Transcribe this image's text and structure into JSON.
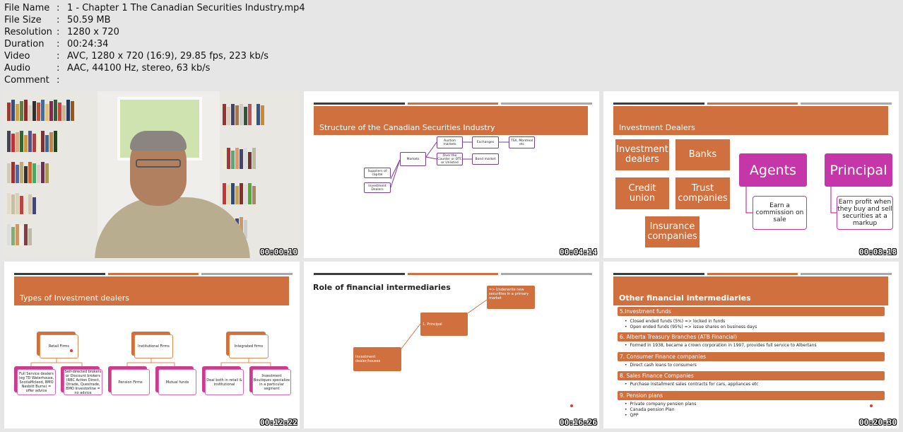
{
  "metadata": [
    {
      "key": "File Name",
      "value": "1 - Chapter 1 The Canadian Securities Industry.mp4"
    },
    {
      "key": "File Size",
      "value": "50.59 MB"
    },
    {
      "key": "Resolution",
      "value": "1280 x 720"
    },
    {
      "key": "Duration",
      "value": "00:24:34"
    },
    {
      "key": "Video",
      "value": "AVC, 1280 x 720 (16:9), 29.85 fps, 223 kb/s"
    },
    {
      "key": "Audio",
      "value": "AAC, 44100 Hz, stereo, 63 kb/s"
    },
    {
      "key": "Comment",
      "value": ""
    }
  ],
  "separator": ":",
  "thumbnails": {
    "t1": {
      "timestamp": "00:00:10"
    },
    "t2": {
      "timestamp": "00:04:14",
      "title": "Structure of the Canadian Securities Industry",
      "boxes": {
        "suppliers": "Suppliers of capital",
        "dealers": "Investment Dealers",
        "markets": "Markets",
        "auction": "Auction markets",
        "otc": "Over the Counter or OTC or Unlisted",
        "exchanges": "Exchanges",
        "bond": "Bond market",
        "tsx": "TSX, Montreal etc"
      }
    },
    "t3": {
      "timestamp": "00:08:18",
      "title": "Investment Dealers",
      "investment_dealers": "Investment dealers",
      "banks": "Banks",
      "credit_union": "Credit union",
      "trust": "Trust companies",
      "insurance": "Insurance companies",
      "agents": "Agents",
      "principal": "Principal",
      "agents_note": "Earn a commission on sale",
      "principal_note": "Earn profit when they buy and sell securities at a markup"
    },
    "t4": {
      "timestamp": "00:12:22",
      "title": "Types of Investment dealers",
      "retail": "Retail Firms",
      "institutional": "Institutional Firms",
      "integrated": "Integrated firms",
      "full_service": "Full Service dealers (eg TD Waterhouse, ScotiaMcleod, BMO Nesbitt Burns) = offer advice",
      "self_directed": "Self-directed brokers or Discount brokers (RBC Action Direct, Qtrade, Questrade, BMO Investorline = no advice",
      "pension": "Pension Firms",
      "mutual": "Mutual funds",
      "deal_both": "Deal both in retail & institutional",
      "boutiques": "Investment Boutiques specialize in a particular segment"
    },
    "t5": {
      "timestamp": "00:16:26",
      "title": "Role of financial intermediaries",
      "dealer_box": "Investment dealer/houses",
      "principal_box": "1. Principal",
      "underwrite_box": "=> Underwrite new securities in a primary market"
    },
    "t6": {
      "timestamp": "00:20:30",
      "title": "Other financial intermediaries",
      "sections": [
        {
          "heading": "5.Investment funds",
          "bullets": [
            "Closed ended funds (5%) => locked in funds",
            "Open ended funds (95%) => issue shares on business days"
          ]
        },
        {
          "heading": "6. Alberta Treasury Branches (ATB Financial)",
          "bullets": [
            "Formed in 1938, became a crown corporation in 1997, provides full service to Albertans"
          ]
        },
        {
          "heading": "7. Consumer Finance companies",
          "bullets": [
            "Direct cash loans to consumers"
          ]
        },
        {
          "heading": "8. Sales Finance Companies",
          "bullets": [
            "Purchase installment sales contracts for cars, appliances etc"
          ]
        },
        {
          "heading": "9. Pension plans",
          "bullets": [
            "Private company pension plans",
            "Canada pension Plan",
            "QPP"
          ]
        }
      ]
    }
  }
}
